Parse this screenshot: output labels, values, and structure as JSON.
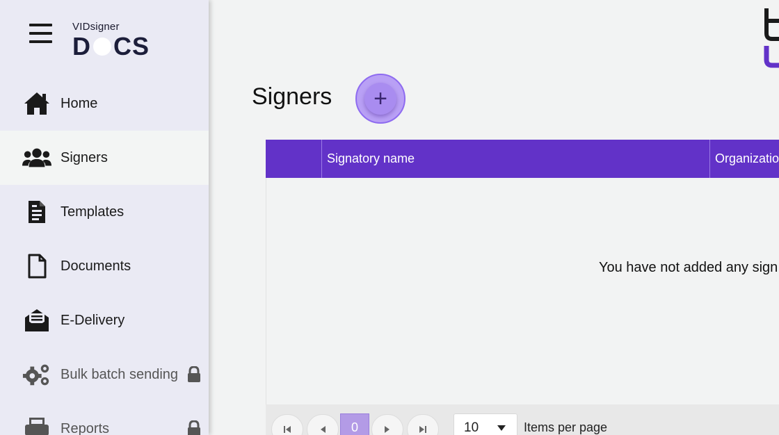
{
  "logo": {
    "top": "VIDsigner",
    "main_left": "D",
    "main_right": "CS"
  },
  "nav": [
    {
      "label": "Home",
      "icon": "home-icon",
      "active": false,
      "locked": false
    },
    {
      "label": "Signers",
      "icon": "users-icon",
      "active": true,
      "locked": false
    },
    {
      "label": "Templates",
      "icon": "document-text-icon",
      "active": false,
      "locked": false
    },
    {
      "label": "Documents",
      "icon": "file-icon",
      "active": false,
      "locked": false
    },
    {
      "label": "E-Delivery",
      "icon": "envelope-open-icon",
      "active": false,
      "locked": false
    },
    {
      "label": "Bulk batch sending",
      "icon": "gears-icon",
      "active": false,
      "locked": true
    },
    {
      "label": "Reports",
      "icon": "printer-icon",
      "active": false,
      "locked": true
    }
  ],
  "page": {
    "title": "Signers",
    "add_button": "+"
  },
  "table": {
    "columns": [
      "Signatory name",
      "Organizatio"
    ],
    "empty_message": "You have not added any sign"
  },
  "pagination": {
    "current_page": "0",
    "per_page": "10",
    "per_page_label": "Items per page"
  },
  "colors": {
    "accent": "#6232c8",
    "sidebar_bg": "#eaeaf4",
    "add_button": "#b9a0f5"
  }
}
